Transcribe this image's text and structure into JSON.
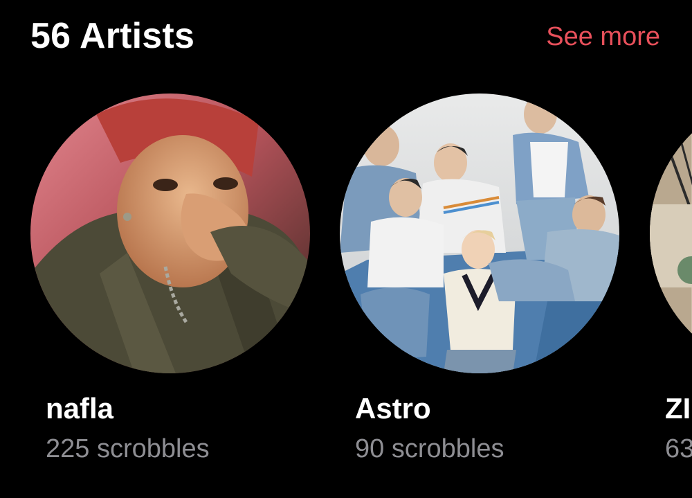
{
  "section": {
    "title": "56 Artists",
    "see_more_label": "See more"
  },
  "artists": [
    {
      "name": "nafla",
      "scrobbles": "225 scrobbles",
      "image": "artist-photo-nafla"
    },
    {
      "name": "Astro",
      "scrobbles": "90 scrobbles",
      "image": "artist-photo-astro"
    },
    {
      "name": "ZI",
      "scrobbles": "63",
      "image": "artist-photo-partial"
    }
  ],
  "colors": {
    "background": "#000000",
    "accent": "#e8505b",
    "primary_text": "#ffffff",
    "secondary_text": "#8e8e93"
  }
}
